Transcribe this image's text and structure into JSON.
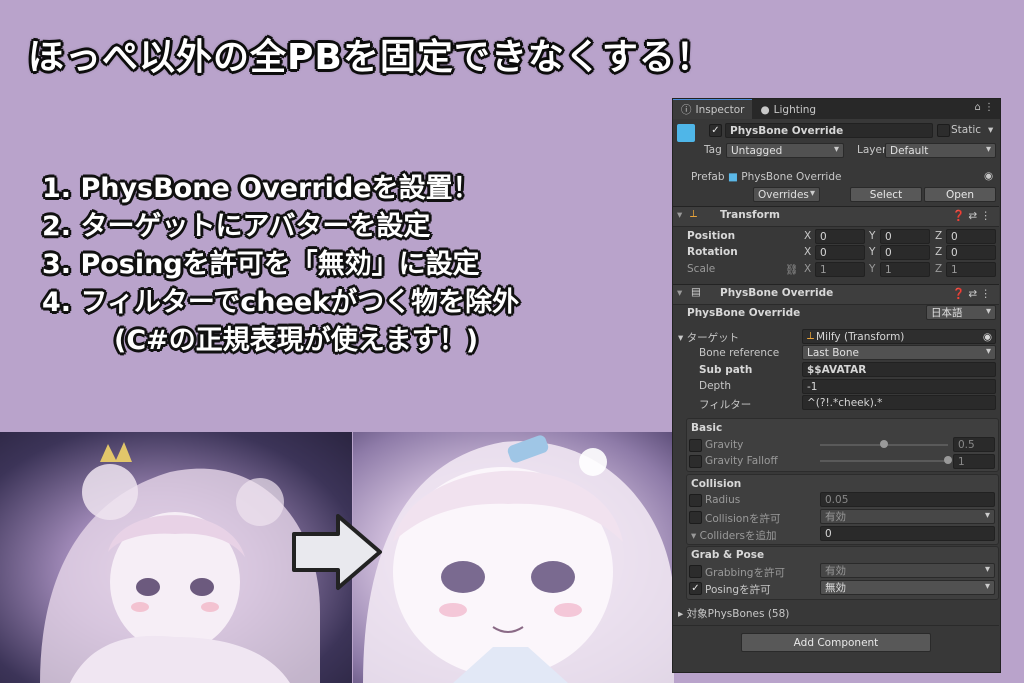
{
  "headline": "ほっぺ以外の全PBを固定できなくする！",
  "steps": [
    "1. PhysBone Overrideを設置！",
    "2. ターゲットにアバターを設定",
    "3. Posingを許可を「無効」に設定",
    "4. フィルターでcheekがつく物を除外",
    "(C#の正規表現が使えます！)"
  ],
  "inspector": {
    "tabs": [
      "Inspector",
      "Lighting"
    ],
    "object_name": "PhysBone Override",
    "static_label": "Static",
    "tag_label": "Tag",
    "tag_value": "Untagged",
    "layer_label": "Layer",
    "layer_value": "Default",
    "prefab_label": "Prefab",
    "prefab_value": "PhysBone Override",
    "overrides_label": "Overrides",
    "select_label": "Select",
    "open_label": "Open",
    "transform": {
      "title": "Transform",
      "position_label": "Position",
      "rotation_label": "Rotation",
      "scale_label": "Scale",
      "axis": [
        "X",
        "Y",
        "Z"
      ],
      "position": [
        "0",
        "0",
        "0"
      ],
      "rotation": [
        "0",
        "0",
        "0"
      ],
      "scale": [
        "1",
        "1",
        "1"
      ]
    },
    "component": {
      "title": "PhysBone Override",
      "name_label": "PhysBone Override",
      "language": "日本語",
      "target_label": "ターゲット",
      "target_value": "Milfy (Transform)",
      "bone_ref_label": "Bone reference",
      "bone_ref_value": "Last Bone",
      "subpath_label": "Sub path",
      "subpath_value": "$$AVATAR",
      "depth_label": "Depth",
      "depth_value": "-1",
      "filter_label": "フィルター",
      "filter_value": "^(?!.*cheek).*",
      "basic_title": "Basic",
      "gravity_label": "Gravity",
      "gravity_value": "0.5",
      "gravity_level": 0.5,
      "gravity_falloff_label": "Gravity Falloff",
      "gravity_falloff_value": "1",
      "gravity_falloff_level": 1,
      "collision_title": "Collision",
      "radius_label": "Radius",
      "radius_value": "0.05",
      "collision_allow_label": "Collisionを許可",
      "collision_allow_value": "有効",
      "colliders_add_label": "Collidersを追加",
      "colliders_add_value": "0",
      "grab_title": "Grab & Pose",
      "grabbing_label": "Grabbingを許可",
      "grabbing_value": "有効",
      "posing_label": "Posingを許可",
      "posing_value": "無効",
      "targets_label": "対象PhysBones (58)",
      "add_component": "Add Component"
    }
  },
  "colors": {
    "background": "#b9a3cb",
    "panel": "#383838",
    "accent": "#4a8ad6"
  }
}
